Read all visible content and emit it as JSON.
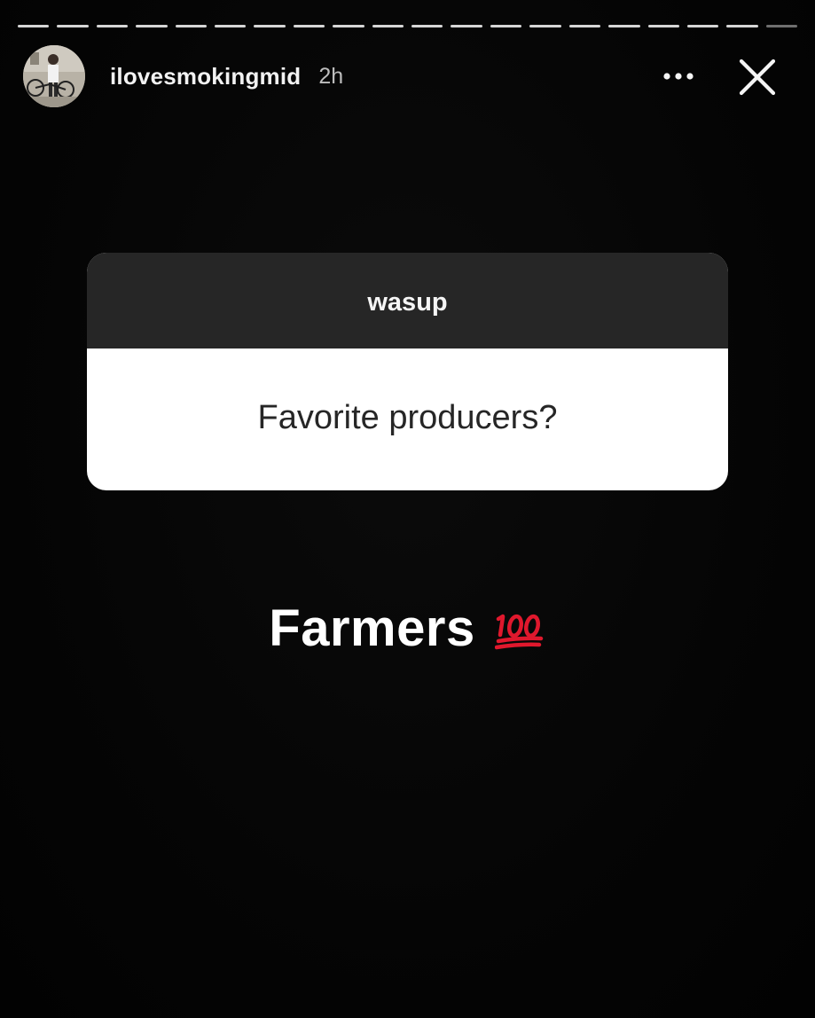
{
  "progress": {
    "segments": 20,
    "viewed": 19
  },
  "header": {
    "username": "ilovesmokingmid",
    "time": "2h",
    "icons": {
      "avatar": "avatar",
      "more": "more-horizontal-icon",
      "close": "close-icon"
    }
  },
  "question_sticker": {
    "prompt": "wasup",
    "question": "Favorite producers?",
    "colors": {
      "header_bg": "#262626",
      "body_bg": "#ffffff",
      "text_dark": "#262626"
    }
  },
  "answer": {
    "text": "Farmers",
    "emoji": "💯",
    "emoji_icon": "hundred-points-icon"
  },
  "colors": {
    "background": "#000000",
    "emoji_red": "#e0182d"
  }
}
